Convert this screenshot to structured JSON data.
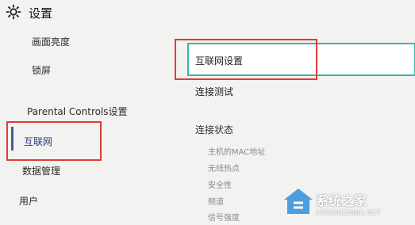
{
  "header": {
    "title": "设置",
    "icon": "gear-icon"
  },
  "sidebar": {
    "items": [
      {
        "label": "画面亮度"
      },
      {
        "label": "锁屏"
      },
      {
        "label": "Parental Controls设置"
      },
      {
        "label": "互联网",
        "active": true
      },
      {
        "label": "数据管理"
      },
      {
        "label": "用户"
      }
    ]
  },
  "main": {
    "selected_item": "互联网设置",
    "items": [
      {
        "label": "连接测试"
      }
    ],
    "status": {
      "title": "连接状态",
      "fields": [
        {
          "label": "主机的MAC地址"
        },
        {
          "label": "无线热点"
        },
        {
          "label": "安全性"
        },
        {
          "label": "频道"
        },
        {
          "label": "信号强度"
        }
      ]
    }
  },
  "watermark": {
    "text": "系统之家",
    "url": "XITONGZHIJIA.NET"
  },
  "colors": {
    "highlight": "#e03a3a",
    "selection_border": "#35b6a6",
    "active_bar": "#4a5a9a"
  }
}
